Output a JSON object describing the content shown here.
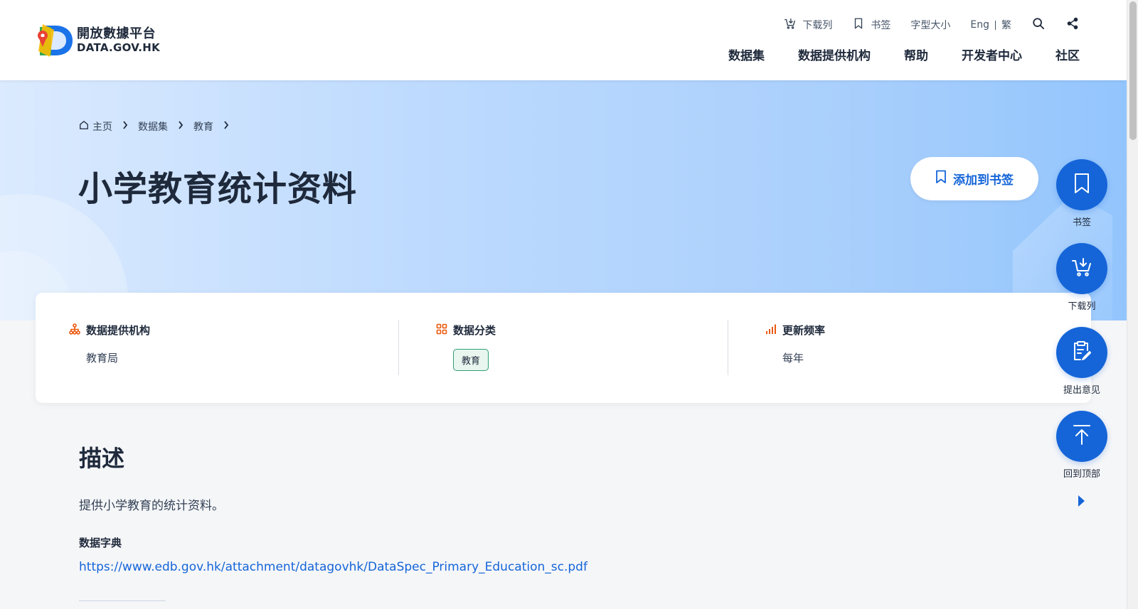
{
  "header": {
    "logo": {
      "cn": "開放數據平台",
      "en": "DATA.GOV.HK"
    },
    "utility": {
      "download_list": "下载列",
      "bookmarks": "书签",
      "font_size": "字型大小",
      "lang_en": "Eng",
      "lang_tc": "繁"
    },
    "nav": [
      "数据集",
      "数据提供机构",
      "帮助",
      "开发者中心",
      "社区"
    ]
  },
  "breadcrumb": {
    "home": "主页",
    "datasets": "数据集",
    "category": "教育"
  },
  "page": {
    "title": "小学教育统计资料",
    "bookmark_button": "添加到书签"
  },
  "info": {
    "provider_label": "数据提供机构",
    "provider_value": "教育局",
    "category_label": "数据分类",
    "category_value": "教育",
    "frequency_label": "更新频率",
    "frequency_value": "每年"
  },
  "description": {
    "heading": "描述",
    "text": "提供小学教育的统计资料。",
    "dictionary_label": "数据字典",
    "dictionary_link": "https://www.edb.gov.hk/attachment/datagovhk/DataSpec_Primary_Education_sc.pdf"
  },
  "floating": {
    "bookmark": "书签",
    "download": "下载列",
    "feedback": "提出意见",
    "top": "回到顶部"
  },
  "colors": {
    "accent": "#1565d8",
    "icon_orange": "#ea580c",
    "tag_border": "#2f9e74"
  }
}
